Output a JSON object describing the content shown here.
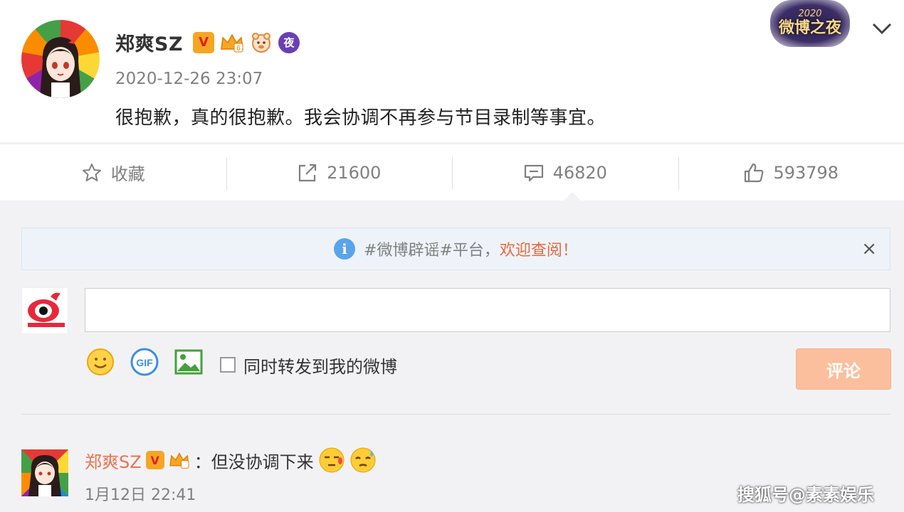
{
  "post": {
    "author": "郑爽SZ",
    "badges": {
      "verified": "V",
      "night": "夜"
    },
    "time": "2020-12-26 23:07",
    "text": "很抱歉，真的很抱歉。我会协调不再参与节目录制等事宜。",
    "event_logo": {
      "year": "2020",
      "title": "微博之夜"
    }
  },
  "actions": {
    "favorite": {
      "label": "收藏",
      "icon": "star-icon"
    },
    "repost": {
      "count": "21600",
      "icon": "share-icon"
    },
    "comment": {
      "count": "46820",
      "icon": "comment-icon"
    },
    "like": {
      "count": "593798",
      "icon": "thumbs-up-icon"
    }
  },
  "notice": {
    "text": "#微博辟谣#平台，",
    "highlight": "欢迎查阅！",
    "close": "×"
  },
  "composer": {
    "input_value": "",
    "repost_checkbox_label": "同时转发到我的微博",
    "submit_label": "评论",
    "tools": [
      "emoji-icon",
      "gif-icon",
      "image-icon"
    ]
  },
  "comment": {
    "author": "郑爽SZ",
    "text": "：但没协调下来",
    "time": "1月12日 22:41"
  },
  "watermark": "搜狐号@素素娱乐",
  "colors": {
    "accent": "#eb7350",
    "submit_disabled": "#fbbf9d",
    "notice_bg": "#eef3f9",
    "info_blue": "#5aa5e8"
  }
}
